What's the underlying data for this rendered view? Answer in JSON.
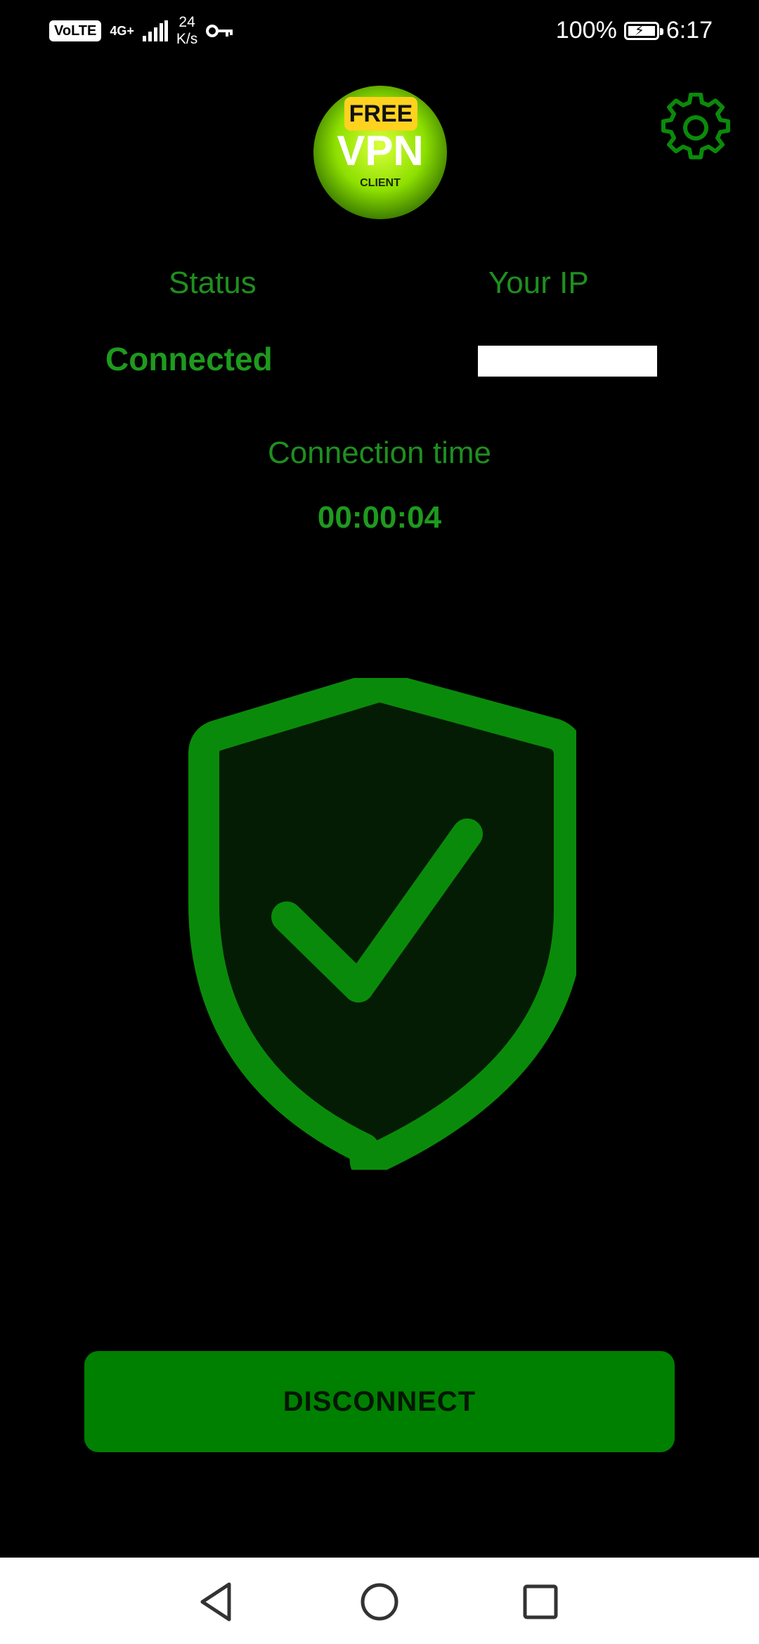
{
  "statusbar": {
    "volte": "VoLTE",
    "network": "4G+",
    "speed_value": "24",
    "speed_unit": "K/s",
    "battery": "100%",
    "time": "6:17"
  },
  "logo": {
    "badge": "FREE",
    "title": "VPN",
    "subtitle": "CLIENT"
  },
  "info": {
    "status_label": "Status",
    "status_value": "Connected",
    "ip_label": "Your IP",
    "ip_value": "",
    "connection_label": "Connection time",
    "connection_time": "00:00:04"
  },
  "actions": {
    "disconnect_label": "DISCONNECT"
  },
  "colors": {
    "accent": "#008000",
    "text_green": "#1f8f1f",
    "background": "#000000"
  }
}
